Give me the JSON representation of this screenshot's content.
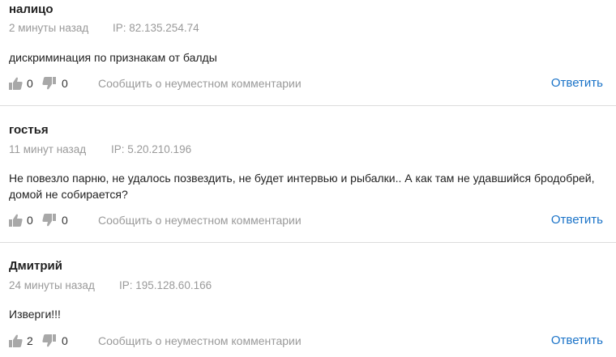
{
  "comments": [
    {
      "author": "налицо",
      "time": "2 минуты назад",
      "ip": "IP: 82.135.254.74",
      "text": "дискриминация по признакам от балды",
      "likes": "0",
      "dislikes": "0",
      "report_label": "Сообщить о неуместном комментарии",
      "reply_label": "Ответить"
    },
    {
      "author": "гостья",
      "time": "11 минут назад",
      "ip": "IP: 5.20.210.196",
      "text": "Не повезло парню, не удалось позвездить, не будет интервью и рыбалки.. А как там не удавшийся бродобрей, домой не собирается?",
      "likes": "0",
      "dislikes": "0",
      "report_label": "Сообщить о неуместном комментарии",
      "reply_label": "Ответить"
    },
    {
      "author": "Дмитрий",
      "time": "24 минуты назад",
      "ip": "IP: 195.128.60.166",
      "text": "Изверги!!!",
      "likes": "2",
      "dislikes": "0",
      "report_label": "Сообщить о неуместном комментарии",
      "reply_label": "Ответить"
    }
  ],
  "icons": {
    "like": "thumbs-up-icon",
    "dislike": "thumbs-down-icon"
  },
  "colors": {
    "link": "#1a73c8",
    "muted": "#9a9a9a",
    "icon": "#a8a8a8",
    "divider": "#dcdcdc"
  }
}
